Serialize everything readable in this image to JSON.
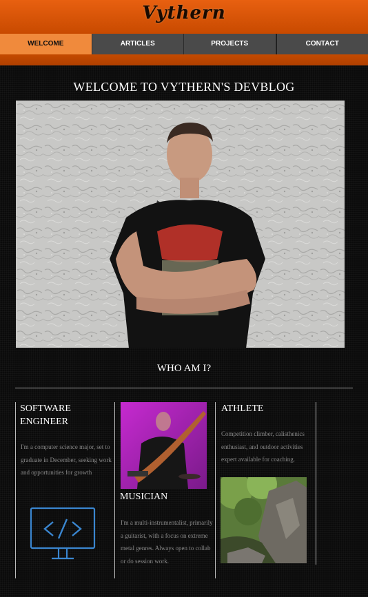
{
  "header": {
    "logo_text": "Vythern"
  },
  "nav": {
    "items": [
      {
        "label": "WELCOME",
        "active": true
      },
      {
        "label": "ARTICLES",
        "active": false
      },
      {
        "label": "PROJECTS",
        "active": false
      },
      {
        "label": "CONTACT",
        "active": false
      }
    ]
  },
  "main": {
    "title": "WELCOME TO VYTHERN'S DEVBLOG",
    "hero_alt": "Portrait of Vythern with arms crossed against a white stucco wall",
    "section_title": "WHO AM I?"
  },
  "cards": {
    "software": {
      "title": "SOFTWARE ENGINEER",
      "text": "I'm a computer science major, set to graduate in December, seeking work and opportunities for growth",
      "icon": "code-monitor-icon"
    },
    "musician": {
      "title": "MUSICIAN",
      "text": "I'm a multi-instrumentalist, primarily a guitarist, with a focus on extreme metal genres. Always open to collab or do session work."
    },
    "athlete": {
      "title": "ATHLETE",
      "text": "Competition climber, calisthenics enthusiast, and outdoor activities expert available for coaching."
    }
  },
  "colors": {
    "header_orange": "#e86010",
    "nav_active": "#f08a3c",
    "nav_bg": "#4a4a4a",
    "icon_blue": "#3a86d0"
  }
}
